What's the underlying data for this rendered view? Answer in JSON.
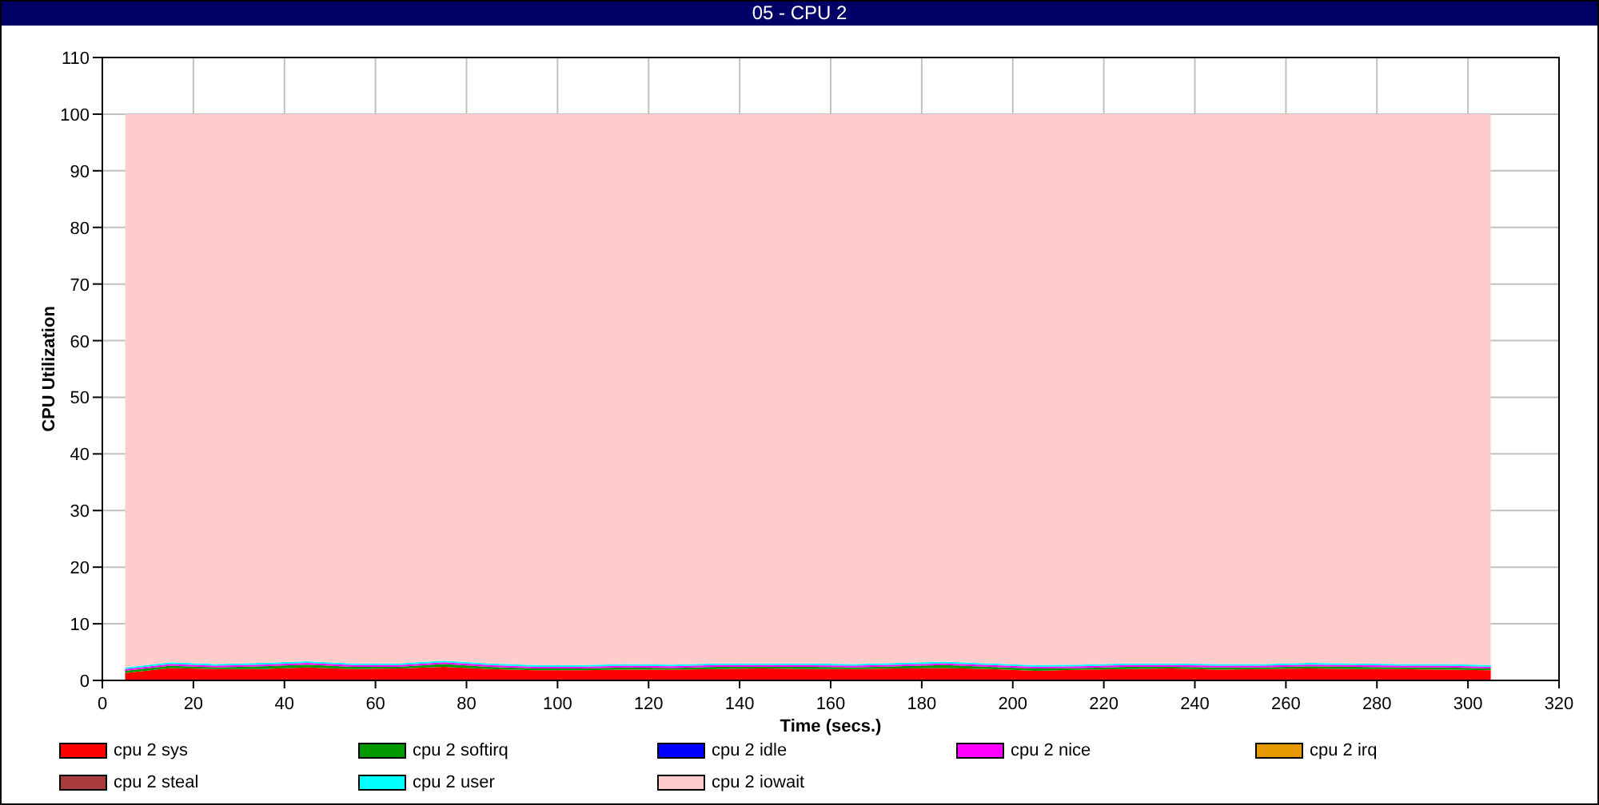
{
  "window": {
    "title": "05 - CPU 2"
  },
  "chart_data": {
    "type": "area",
    "stacked": true,
    "grid": true,
    "xlabel": "Time (secs.)",
    "ylabel": "CPU Utilization",
    "xlim": [
      0,
      320
    ],
    "ylim": [
      0,
      110
    ],
    "xticks": [
      0,
      20,
      40,
      60,
      80,
      100,
      120,
      140,
      160,
      180,
      200,
      220,
      240,
      260,
      280,
      300,
      320
    ],
    "yticks": [
      0,
      10,
      20,
      30,
      40,
      50,
      60,
      70,
      80,
      90,
      100,
      110
    ],
    "x": [
      5,
      15,
      25,
      35,
      45,
      55,
      65,
      75,
      85,
      95,
      105,
      115,
      125,
      135,
      145,
      155,
      165,
      175,
      185,
      195,
      205,
      215,
      225,
      235,
      245,
      255,
      265,
      275,
      285,
      295,
      305
    ],
    "series": [
      {
        "name": "cpu 2 sys",
        "color": "#ff0000",
        "values": [
          1.3,
          2.2,
          2.0,
          2.0,
          2.3,
          2.0,
          2.1,
          2.4,
          2.0,
          1.8,
          1.8,
          1.9,
          1.9,
          2.0,
          2.1,
          2.0,
          2.0,
          2.1,
          2.2,
          2.0,
          1.7,
          1.9,
          2.0,
          2.1,
          1.9,
          2.0,
          2.1,
          2.0,
          2.0,
          1.9,
          1.8
        ]
      },
      {
        "name": "cpu 2 softirq",
        "color": "#009900",
        "values": [
          0.4,
          0.4,
          0.3,
          0.5,
          0.5,
          0.4,
          0.3,
          0.5,
          0.4,
          0.3,
          0.3,
          0.4,
          0.3,
          0.4,
          0.3,
          0.4,
          0.3,
          0.4,
          0.5,
          0.4,
          0.4,
          0.3,
          0.4,
          0.3,
          0.4,
          0.3,
          0.4,
          0.4,
          0.3,
          0.4,
          0.3
        ]
      },
      {
        "name": "cpu 2 idle",
        "color": "#0000ff",
        "values": [
          null,
          null,
          null,
          null,
          null,
          null,
          null,
          null,
          null,
          null,
          null,
          null,
          null,
          null,
          null,
          null,
          null,
          null,
          null,
          null,
          null,
          null,
          null,
          null,
          null,
          null,
          null,
          null,
          null,
          null,
          null
        ]
      },
      {
        "name": "cpu 2 nice",
        "color": "#ff00ff",
        "values": [
          0.3,
          0.3,
          0.3,
          0.3,
          0.3,
          0.3,
          0.3,
          0.3,
          0.3,
          0.3,
          0.3,
          0.3,
          0.3,
          0.3,
          0.3,
          0.3,
          0.3,
          0.3,
          0.3,
          0.3,
          0.3,
          0.3,
          0.3,
          0.3,
          0.3,
          0.3,
          0.3,
          0.3,
          0.3,
          0.3,
          0.3
        ]
      },
      {
        "name": "cpu 2 irq",
        "color": "#e69900",
        "values": [
          null,
          null,
          null,
          null,
          null,
          null,
          null,
          null,
          null,
          null,
          null,
          null,
          null,
          null,
          null,
          null,
          null,
          null,
          null,
          null,
          null,
          null,
          null,
          null,
          null,
          null,
          null,
          null,
          null,
          null,
          null
        ]
      },
      {
        "name": "cpu 2 steal",
        "color": "#a83c3c",
        "values": [
          null,
          null,
          null,
          null,
          null,
          null,
          null,
          null,
          null,
          null,
          null,
          null,
          null,
          null,
          null,
          null,
          null,
          null,
          null,
          null,
          null,
          null,
          null,
          null,
          null,
          null,
          null,
          null,
          null,
          null,
          null
        ]
      },
      {
        "name": "cpu 2 user",
        "color": "#00ffff",
        "values": [
          0.3,
          0.3,
          0.3,
          0.3,
          0.3,
          0.3,
          0.3,
          0.3,
          0.3,
          0.3,
          0.3,
          0.3,
          0.3,
          0.3,
          0.3,
          0.3,
          0.3,
          0.3,
          0.3,
          0.3,
          0.3,
          0.3,
          0.3,
          0.3,
          0.3,
          0.3,
          0.3,
          0.3,
          0.3,
          0.3,
          0.3
        ]
      },
      {
        "name": "cpu 2 iowait",
        "color": "#ffcccc",
        "values": [
          97.7,
          96.8,
          97.1,
          96.9,
          96.6,
          97.0,
          97.0,
          96.5,
          97.0,
          97.3,
          97.3,
          97.1,
          97.2,
          97.0,
          97.0,
          97.0,
          97.1,
          96.9,
          96.7,
          97.0,
          97.3,
          97.2,
          97.0,
          97.0,
          97.1,
          97.1,
          96.9,
          97.0,
          97.1,
          97.1,
          97.3
        ]
      }
    ]
  }
}
